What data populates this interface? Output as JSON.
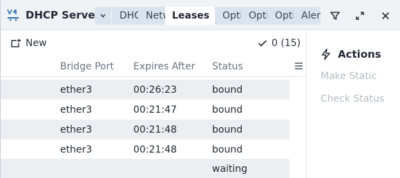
{
  "header": {
    "title": "DHCP Server",
    "tabs": [
      {
        "label": "DHCP"
      },
      {
        "label": "Networks"
      },
      {
        "label": "Leases"
      },
      {
        "label": "Options"
      },
      {
        "label": "Option Sets"
      },
      {
        "label": "Option Matchers"
      },
      {
        "label": "Alerts"
      }
    ]
  },
  "toolbar": {
    "new_label": "New",
    "count": "0 (15)"
  },
  "table": {
    "columns": [
      "Bridge Port",
      "Expires After",
      "Status"
    ],
    "rows": [
      {
        "bridge_port": "ether3",
        "expires_after": "00:26:23",
        "status": "bound"
      },
      {
        "bridge_port": "ether3",
        "expires_after": "00:21:47",
        "status": "bound"
      },
      {
        "bridge_port": "ether3",
        "expires_after": "00:21:48",
        "status": "bound"
      },
      {
        "bridge_port": "ether3",
        "expires_after": "00:21:48",
        "status": "bound"
      },
      {
        "bridge_port": "",
        "expires_after": "",
        "status": "waiting"
      }
    ]
  },
  "actions": {
    "title": "Actions",
    "items": [
      "Make Static",
      "Check Status"
    ]
  },
  "colors": {
    "header_bg": "#f0f3f6",
    "tab_bg": "#dbe4ee",
    "row_alt": "#eceef1",
    "disabled_text": "#b7bcc4"
  }
}
